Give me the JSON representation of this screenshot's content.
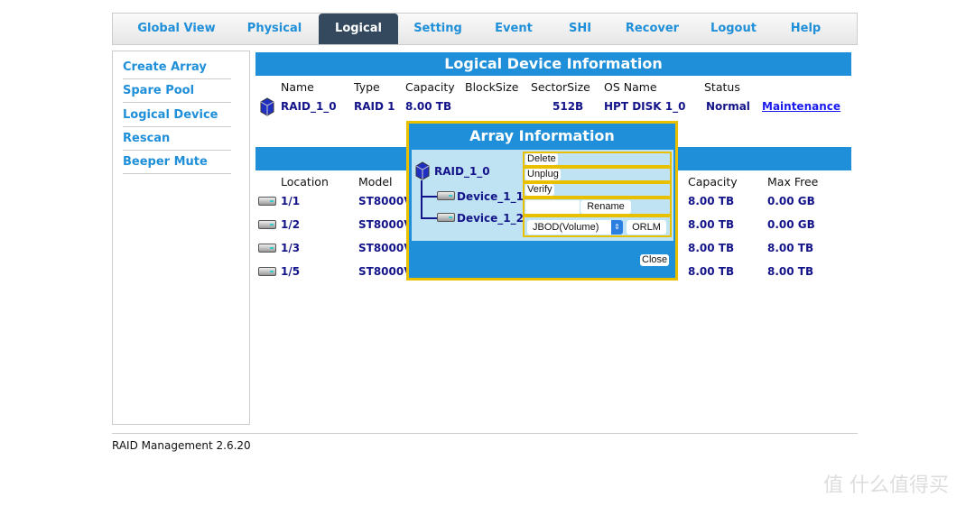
{
  "tabs": [
    "Global View",
    "Physical",
    "Logical",
    "Setting",
    "Event",
    "SHI",
    "Recover",
    "Logout",
    "Help"
  ],
  "active_tab": "Logical",
  "sidebar": [
    "Create Array",
    "Spare Pool",
    "Logical Device",
    "Rescan",
    "Beeper Mute"
  ],
  "logical": {
    "title": "Logical Device Information",
    "headers": [
      "Name",
      "Type",
      "Capacity",
      "BlockSize",
      "SectorSize",
      "OS Name",
      "Status"
    ],
    "row": {
      "name": "RAID_1_0",
      "type": "RAID 1",
      "capacity": "8.00 TB",
      "blocksize": "",
      "sectorsize": "512B",
      "osname": "HPT DISK 1_0",
      "status": "Normal",
      "action": "Maintenance"
    }
  },
  "physical": {
    "headers": {
      "location": "Location",
      "model": "Model",
      "capacity": "Capacity",
      "maxfree": "Max Free"
    },
    "rows": [
      {
        "location": "1/1",
        "model": "ST8000V",
        "capacity": "8.00 TB",
        "maxfree": "0.00 GB"
      },
      {
        "location": "1/2",
        "model": "ST8000V",
        "capacity": "8.00 TB",
        "maxfree": "0.00 GB"
      },
      {
        "location": "1/3",
        "model": "ST8000V",
        "capacity": "8.00 TB",
        "maxfree": "8.00 TB"
      },
      {
        "location": "1/5",
        "model": "ST8000V",
        "capacity": "8.00 TB",
        "maxfree": "8.00 TB"
      }
    ]
  },
  "dialog": {
    "title": "Array Information",
    "array": "RAID_1_0",
    "devices": [
      "Device_1_1",
      "Device_1_2"
    ],
    "buttons": {
      "delete": "Delete",
      "unplug": "Unplug",
      "verify": "Verify",
      "rename": "Rename",
      "orlm": "ORLM",
      "close": "Close"
    },
    "rename_value": "",
    "select_value": "JBOD(Volume)"
  },
  "footer": "RAID Management 2.6.20",
  "watermark": "值 什么值得买",
  "colors": {
    "accent": "#1e8fd8",
    "active_tab": "#34495e",
    "dialog_border": "#e8c000",
    "text_dark": "#14148a"
  }
}
